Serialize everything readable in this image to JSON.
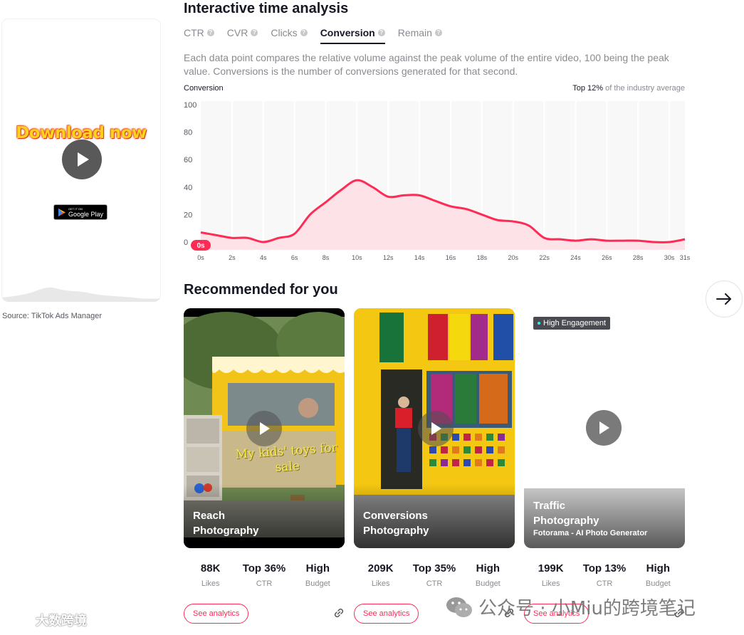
{
  "preview": {
    "download_text": "Download now",
    "gplay_small": "GET IT ON",
    "gplay_big": "Google Play",
    "source": "Source: TikTok Ads Manager"
  },
  "analysis": {
    "title": "Interactive time analysis",
    "tabs": [
      {
        "label": "CTR",
        "active": false
      },
      {
        "label": "CVR",
        "active": false
      },
      {
        "label": "Clicks",
        "active": false
      },
      {
        "label": "Conversion",
        "active": true
      },
      {
        "label": "Remain",
        "active": false
      }
    ],
    "description": "Each data point compares the relative volume against the peak volume of the entire video, 100 being the peak value. Conversions is the number of conversions generated for that second.",
    "metric_label": "Conversion",
    "industry_top": "Top 12%",
    "industry_rest": " of the industry average",
    "current_time": "0s"
  },
  "chart_data": {
    "type": "area",
    "ylabel": "",
    "xlabel": "",
    "ylim": [
      0,
      100
    ],
    "yticks": [
      "100",
      "80",
      "60",
      "40",
      "20",
      "0"
    ],
    "xlim": [
      0,
      31
    ],
    "xticks": [
      "0s",
      "2s",
      "4s",
      "6s",
      "8s",
      "10s",
      "12s",
      "14s",
      "16s",
      "18s",
      "20s",
      "22s",
      "24s",
      "26s",
      "28s",
      "30s",
      "31s"
    ],
    "series": [
      {
        "x": [
          0,
          1,
          2,
          3,
          4,
          5,
          6,
          7,
          8,
          9,
          10,
          11,
          12,
          13,
          14,
          15,
          16,
          17,
          18,
          19,
          20,
          21,
          22,
          23,
          24,
          25,
          26,
          27,
          28,
          29,
          30,
          31
        ],
        "values": [
          7,
          5,
          3,
          3,
          0,
          3,
          6,
          20,
          29,
          38,
          45,
          40,
          33,
          34,
          34,
          30,
          26,
          24,
          20,
          16,
          15,
          12,
          3,
          2,
          1,
          2,
          1,
          1,
          1,
          0,
          0,
          2
        ]
      }
    ],
    "colors": {
      "line": "#fe2c55",
      "fill": "#fde3e8",
      "plot_bg": "#f8f8f8"
    }
  },
  "recommended": {
    "title": "Recommended for you",
    "see_analytics": "See analytics",
    "cards": [
      {
        "title": "Reach",
        "subtitle": "Photography",
        "sub2": "",
        "badge": "",
        "inner_sign": "My kids' toys for sale",
        "stats": [
          {
            "value": "88K",
            "label": "Likes"
          },
          {
            "value": "Top 36%",
            "label": "CTR"
          },
          {
            "value": "High",
            "label": "Budget"
          }
        ]
      },
      {
        "title": "Conversions",
        "subtitle": "Photography",
        "sub2": "",
        "badge": "",
        "stats": [
          {
            "value": "209K",
            "label": "Likes"
          },
          {
            "value": "Top 35%",
            "label": "CTR"
          },
          {
            "value": "High",
            "label": "Budget"
          }
        ]
      },
      {
        "title": "Traffic",
        "subtitle": "Photography",
        "sub2": "Fotorama - AI Photo Generator",
        "badge": "High Engagement",
        "stats": [
          {
            "value": "199K",
            "label": "Likes"
          },
          {
            "value": "Top 13%",
            "label": "CTR"
          },
          {
            "value": "High",
            "label": "Budget"
          }
        ]
      }
    ]
  },
  "watermarks": {
    "wechat": "公众号 · 小Miu的跨境笔记",
    "brand": "大数跨境"
  }
}
